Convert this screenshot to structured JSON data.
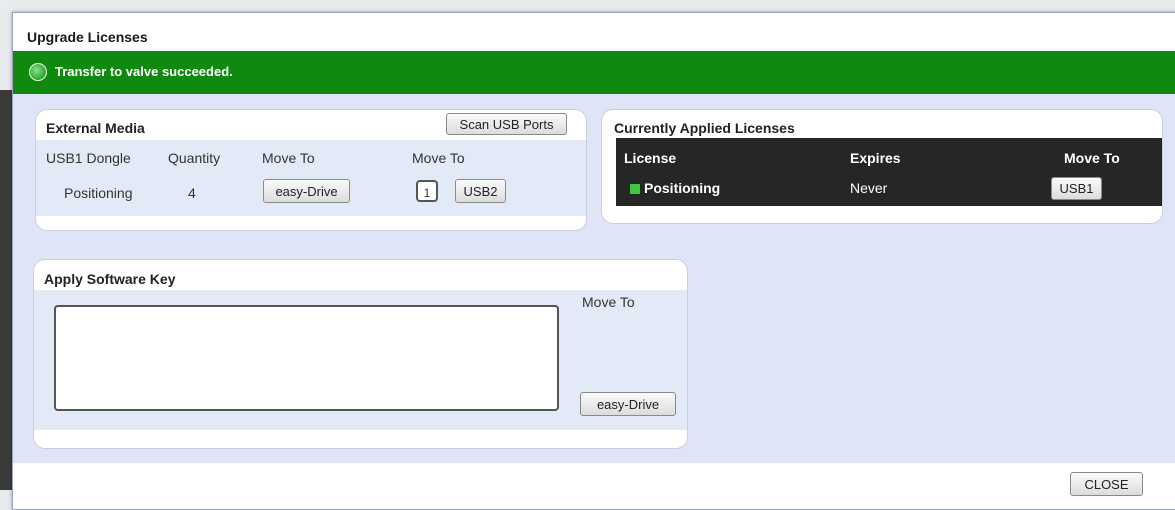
{
  "dialog": {
    "title": "Upgrade Licenses",
    "close_label": "CLOSE"
  },
  "status": {
    "message": "Transfer to valve succeeded.",
    "color": "#0f8a0f"
  },
  "external_media": {
    "title": "External Media",
    "scan_button": "Scan USB Ports",
    "headers": {
      "device": "USB1 Dongle",
      "quantity": "Quantity",
      "move_to_1": "Move To",
      "move_to_2": "Move To"
    },
    "row": {
      "name": "Positioning",
      "quantity": "4",
      "move_button": "easy-Drive",
      "count": "1",
      "usb_button": "USB2"
    }
  },
  "current_licenses": {
    "title": "Currently Applied Licenses",
    "headers": {
      "license": "License",
      "expires": "Expires",
      "move_to": "Move To"
    },
    "row": {
      "license": "Positioning",
      "expires": "Never",
      "move_button": "USB1"
    }
  },
  "software_key": {
    "title": "Apply Software Key",
    "move_to_label": "Move To",
    "move_button": "easy-Drive",
    "key_value": ""
  }
}
